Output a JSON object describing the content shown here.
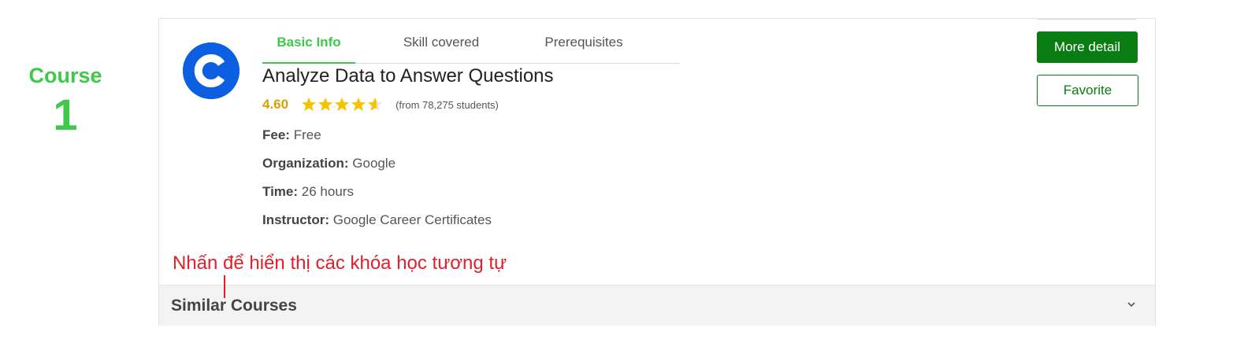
{
  "course_index": {
    "label": "Course",
    "number": "1"
  },
  "logo": {
    "letter_icon": "coursera-c-logo-icon",
    "color": "#0b5fe0"
  },
  "tabs": [
    {
      "label": "Basic Info",
      "active": true
    },
    {
      "label": "Skill covered",
      "active": false
    },
    {
      "label": "Prerequisites",
      "active": false
    }
  ],
  "course": {
    "title": "Analyze Data to Answer Questions",
    "rating": "4.60",
    "rating_value": 4.6,
    "stars_max": 5,
    "students": "(from 78,275 students)",
    "fee_label": "Fee:",
    "fee": "Free",
    "org_label": "Organization:",
    "org": "Google",
    "time_label": "Time:",
    "time": "26 hours",
    "instructor_label": "Instructor:",
    "instructor": "Google Career Certificates"
  },
  "buttons": {
    "more_detail": "More detail",
    "favorite": "Favorite"
  },
  "annotation": "Nhấn để hiển thị các khóa học tương tự",
  "similar": {
    "label": "Similar Courses",
    "icon": "chevron-down-icon"
  },
  "colors": {
    "accent_green": "#3ec94a",
    "button_green": "#0a7d12",
    "star": "#f5c400",
    "rating": "#d79f00",
    "annotation_red": "#e0202a"
  }
}
